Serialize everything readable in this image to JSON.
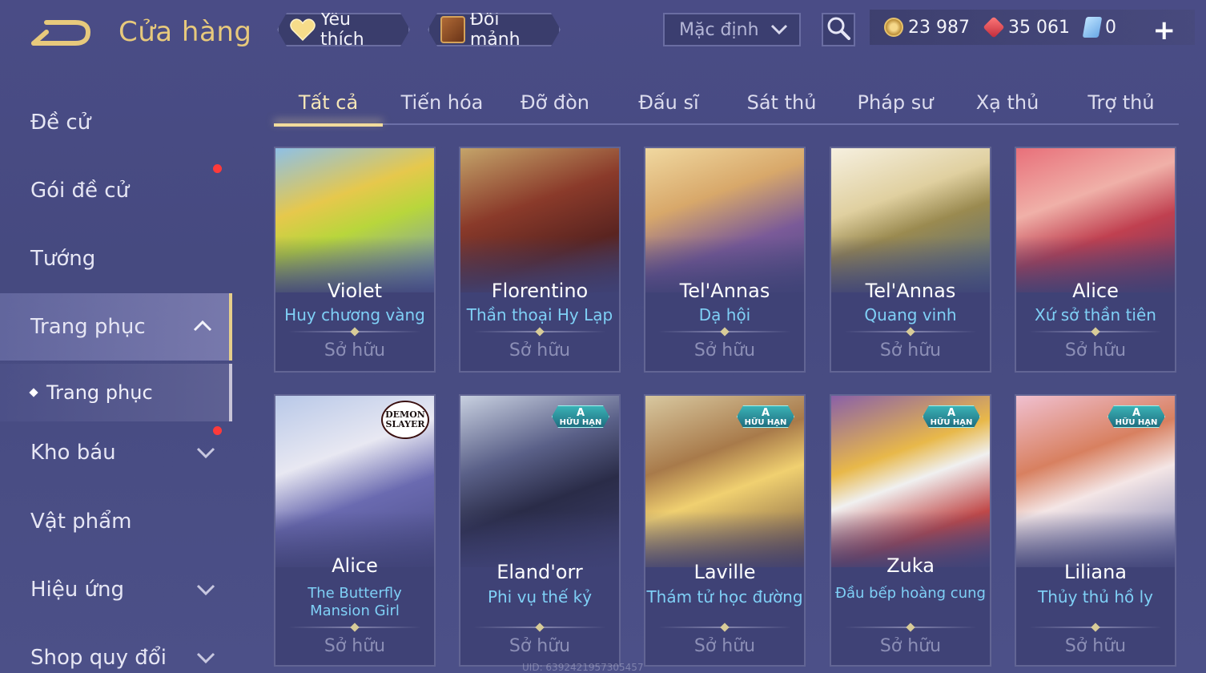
{
  "header": {
    "title": "Cửa hàng",
    "favorites_label": "Yêu thích",
    "shard_label": "Đổi mảnh",
    "sort": {
      "selected": "Mặc định"
    },
    "currencies": {
      "gold": "23 987",
      "gems": "35 061",
      "vouchers": "0"
    },
    "plus_label": "+"
  },
  "sidebar": {
    "items": [
      {
        "label": "Đề cử"
      },
      {
        "label": "Gói đề cử"
      },
      {
        "label": "Tướng"
      },
      {
        "label": "Trang phục"
      },
      {
        "label": "Kho báu"
      },
      {
        "label": "Vật phẩm"
      },
      {
        "label": "Hiệu ứng"
      },
      {
        "label": "Shop quy đổi"
      }
    ],
    "sub_item": {
      "label": "Trang phục"
    }
  },
  "tabs": [
    {
      "label": "Tất cả"
    },
    {
      "label": "Tiến hóa"
    },
    {
      "label": "Đỡ đòn"
    },
    {
      "label": "Đấu sĩ"
    },
    {
      "label": "Sát thủ"
    },
    {
      "label": "Pháp sư"
    },
    {
      "label": "Xạ thủ"
    },
    {
      "label": "Trợ thủ"
    }
  ],
  "status_owned": "Sở hữu",
  "badge": {
    "letter": "A",
    "text": "HỮU HẠN"
  },
  "collab_logo": {
    "line1": "DEMON",
    "line2": "SLAYER"
  },
  "cards": [
    {
      "hero": "Violet",
      "skin": "Huy chương vàng",
      "status": "Sở hữu"
    },
    {
      "hero": "Florentino",
      "skin": "Thần thoại Hy Lạp",
      "status": "Sở hữu"
    },
    {
      "hero": "Tel'Annas",
      "skin": "Dạ hội",
      "status": "Sở hữu"
    },
    {
      "hero": "Tel'Annas",
      "skin": "Quang vinh",
      "status": "Sở hữu"
    },
    {
      "hero": "Alice",
      "skin": "Xứ sở thần tiên",
      "status": "Sở hữu"
    },
    {
      "hero": "Alice",
      "skin": "The Butterfly Mansion Girl",
      "status": "Sở hữu"
    },
    {
      "hero": "Eland'orr",
      "skin": "Phi vụ thế kỷ",
      "status": "Sở hữu"
    },
    {
      "hero": "Laville",
      "skin": "Thám tử học đường",
      "status": "Sở hữu"
    },
    {
      "hero": "Zuka",
      "skin": "Đầu bếp hoàng cung",
      "status": "Sở hữu"
    },
    {
      "hero": "Liliana",
      "skin": "Thủy thủ hồ ly",
      "status": "Sở hữu"
    }
  ],
  "uid_text": "UID: 6392421957305457"
}
